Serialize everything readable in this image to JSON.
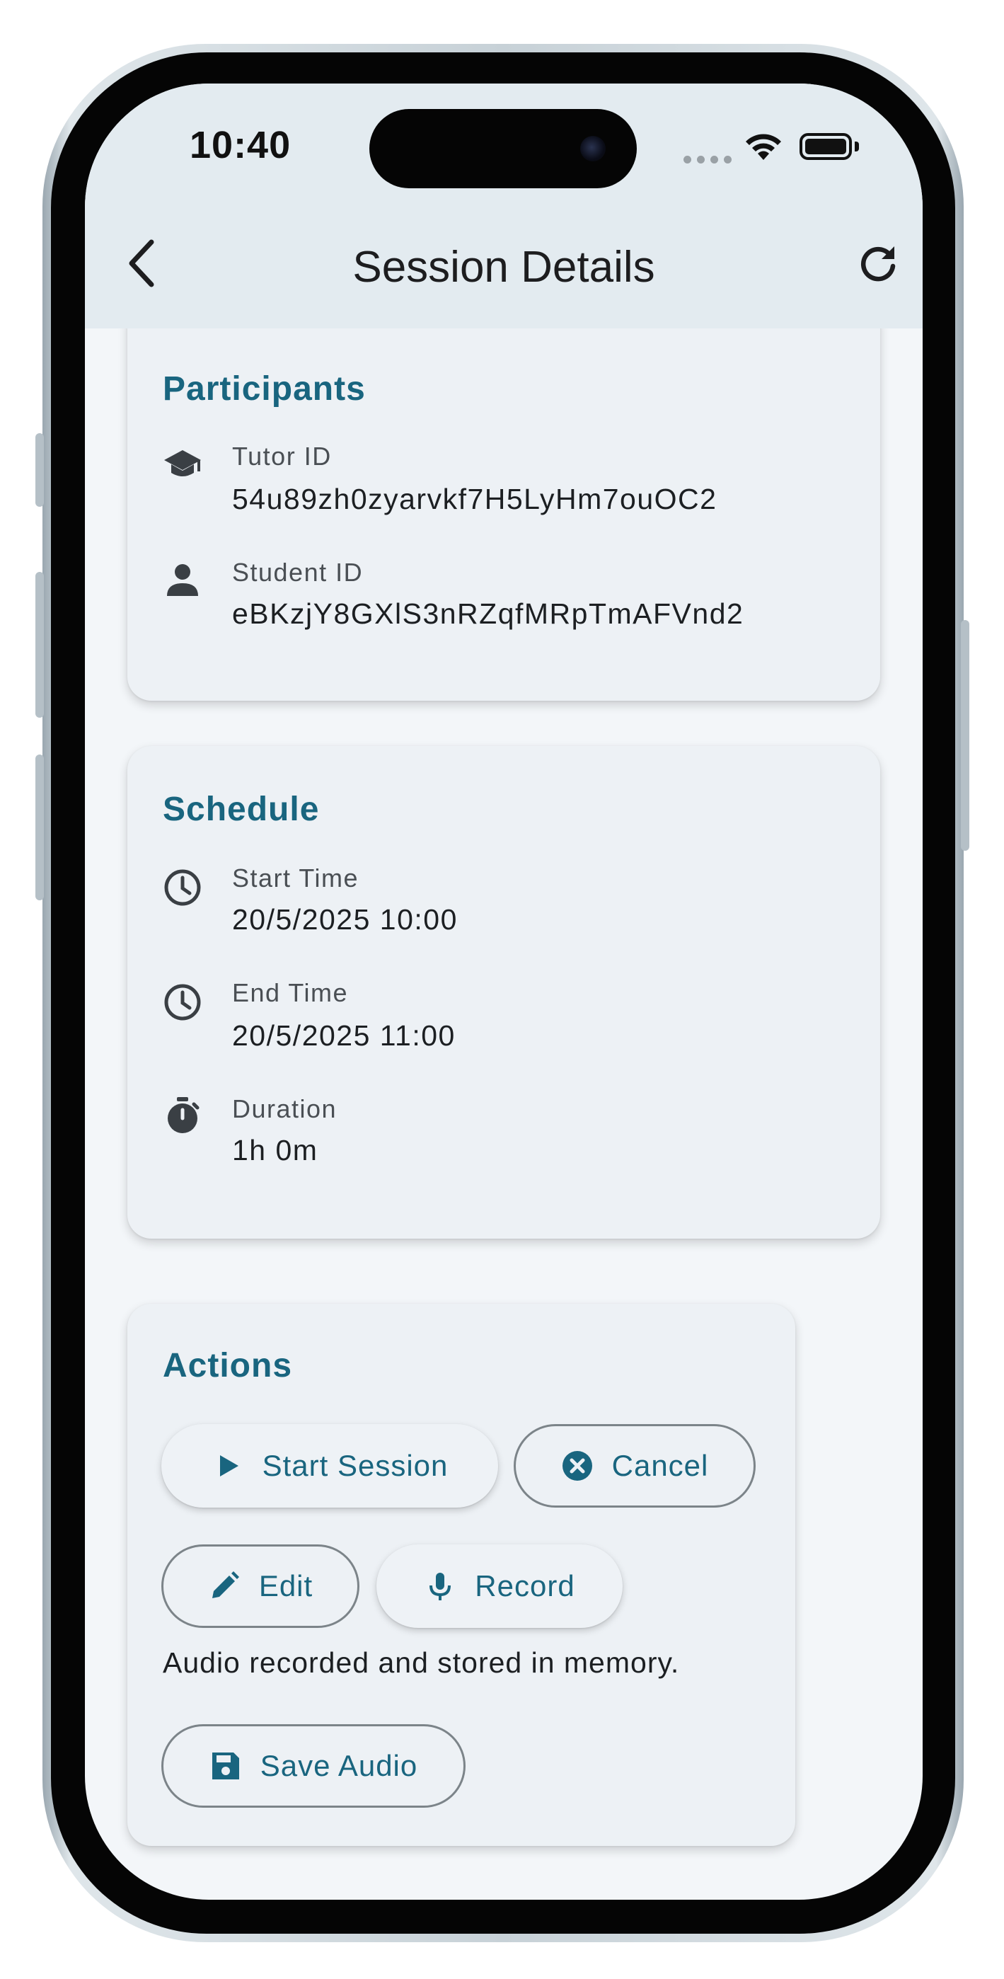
{
  "status_bar": {
    "time": "10:40"
  },
  "app_bar": {
    "title": "Session Details"
  },
  "participants": {
    "title": "Participants",
    "tutor_label": "Tutor ID",
    "tutor_value": "54u89zh0zyarvkf7H5LyHm7ouOC2",
    "student_label": "Student ID",
    "student_value": "eBKzjY8GXlS3nRZqfMRpTmAFVnd2"
  },
  "schedule": {
    "title": "Schedule",
    "start_label": "Start Time",
    "start_value": "20/5/2025 10:00",
    "end_label": "End Time",
    "end_value": "20/5/2025 11:00",
    "duration_label": "Duration",
    "duration_value": "1h 0m"
  },
  "actions": {
    "title": "Actions",
    "start_session": "Start Session",
    "cancel": "Cancel",
    "edit": "Edit",
    "record": "Record",
    "status_message": "Audio recorded and stored in memory.",
    "save_audio": "Save Audio"
  },
  "colors": {
    "accent": "#19657f",
    "app_bar_bg": "#e3ebf0",
    "card_bg": "#edf1f5",
    "screen_bg": "#f3f6f9"
  }
}
